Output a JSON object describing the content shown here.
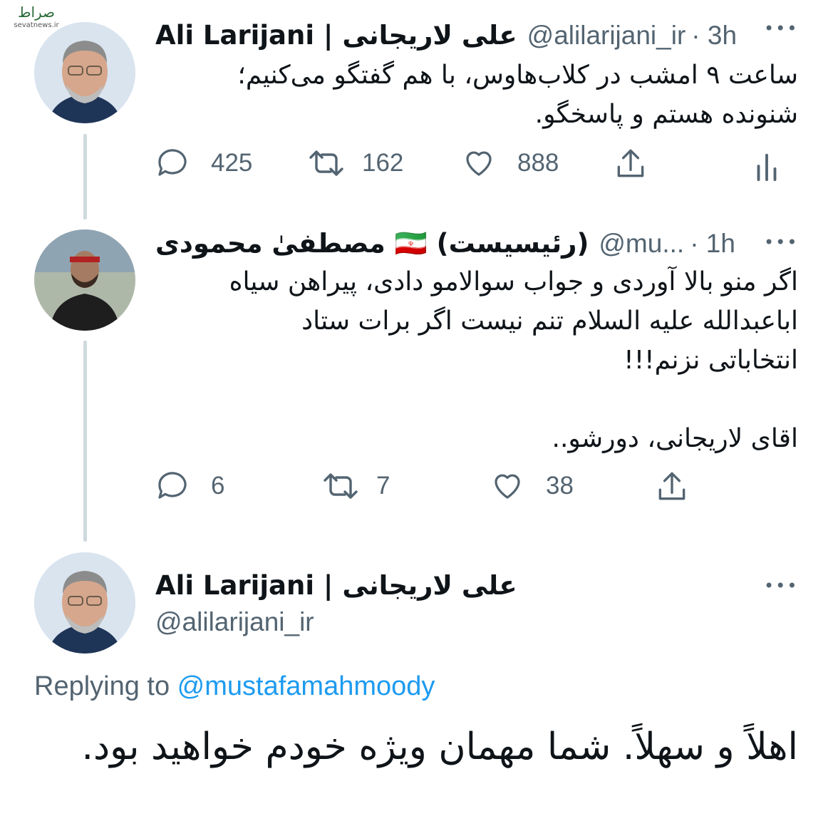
{
  "watermark": {
    "logo_text": "صراط",
    "sub": "sevatnews.ir"
  },
  "tweets": [
    {
      "name": "Ali Larijani | علی لاریجانی",
      "handle": "@alilarijani_ir",
      "time": "· 3h",
      "text": "ساعت ۹ امشب در کلاب‌هاوس، با هم گفتگو می‌کنیم؛\nشنونده هستم و پاسخگو.",
      "replies": "425",
      "retweets": "162",
      "likes": "888",
      "more": "•••"
    },
    {
      "name": "(رئیسیست) 🇮🇷 مصطفیٰ محمودی",
      "handle": "@mu... ",
      "time": "· 1h",
      "text": "اگر منو بالا آوردی و جواب سوالامو دادی، پیراهن سیاه\nاباعبدالله علیه السلام تنم نیست اگر برات ستاد\nانتخاباتی نزنم!!!\n\nاقای لاریجانی، دورشو..",
      "replies": "6",
      "retweets": "7",
      "likes": "38",
      "more": "•••"
    }
  ],
  "main_tweet": {
    "name": "Ali Larijani | علی لاریجانی",
    "handle": "@alilarijani_ir",
    "more": "•••",
    "replying_prefix": "Replying to ",
    "replying_handle": "@mustafamahmoody",
    "text": "اهلاً و سهلاً. شما مهمان ویژه خودم خواهید بود."
  },
  "icons": [
    "reply-icon",
    "retweet-icon",
    "like-icon",
    "share-icon",
    "analytics-icon",
    "more-icon",
    "iran-flag-icon"
  ]
}
